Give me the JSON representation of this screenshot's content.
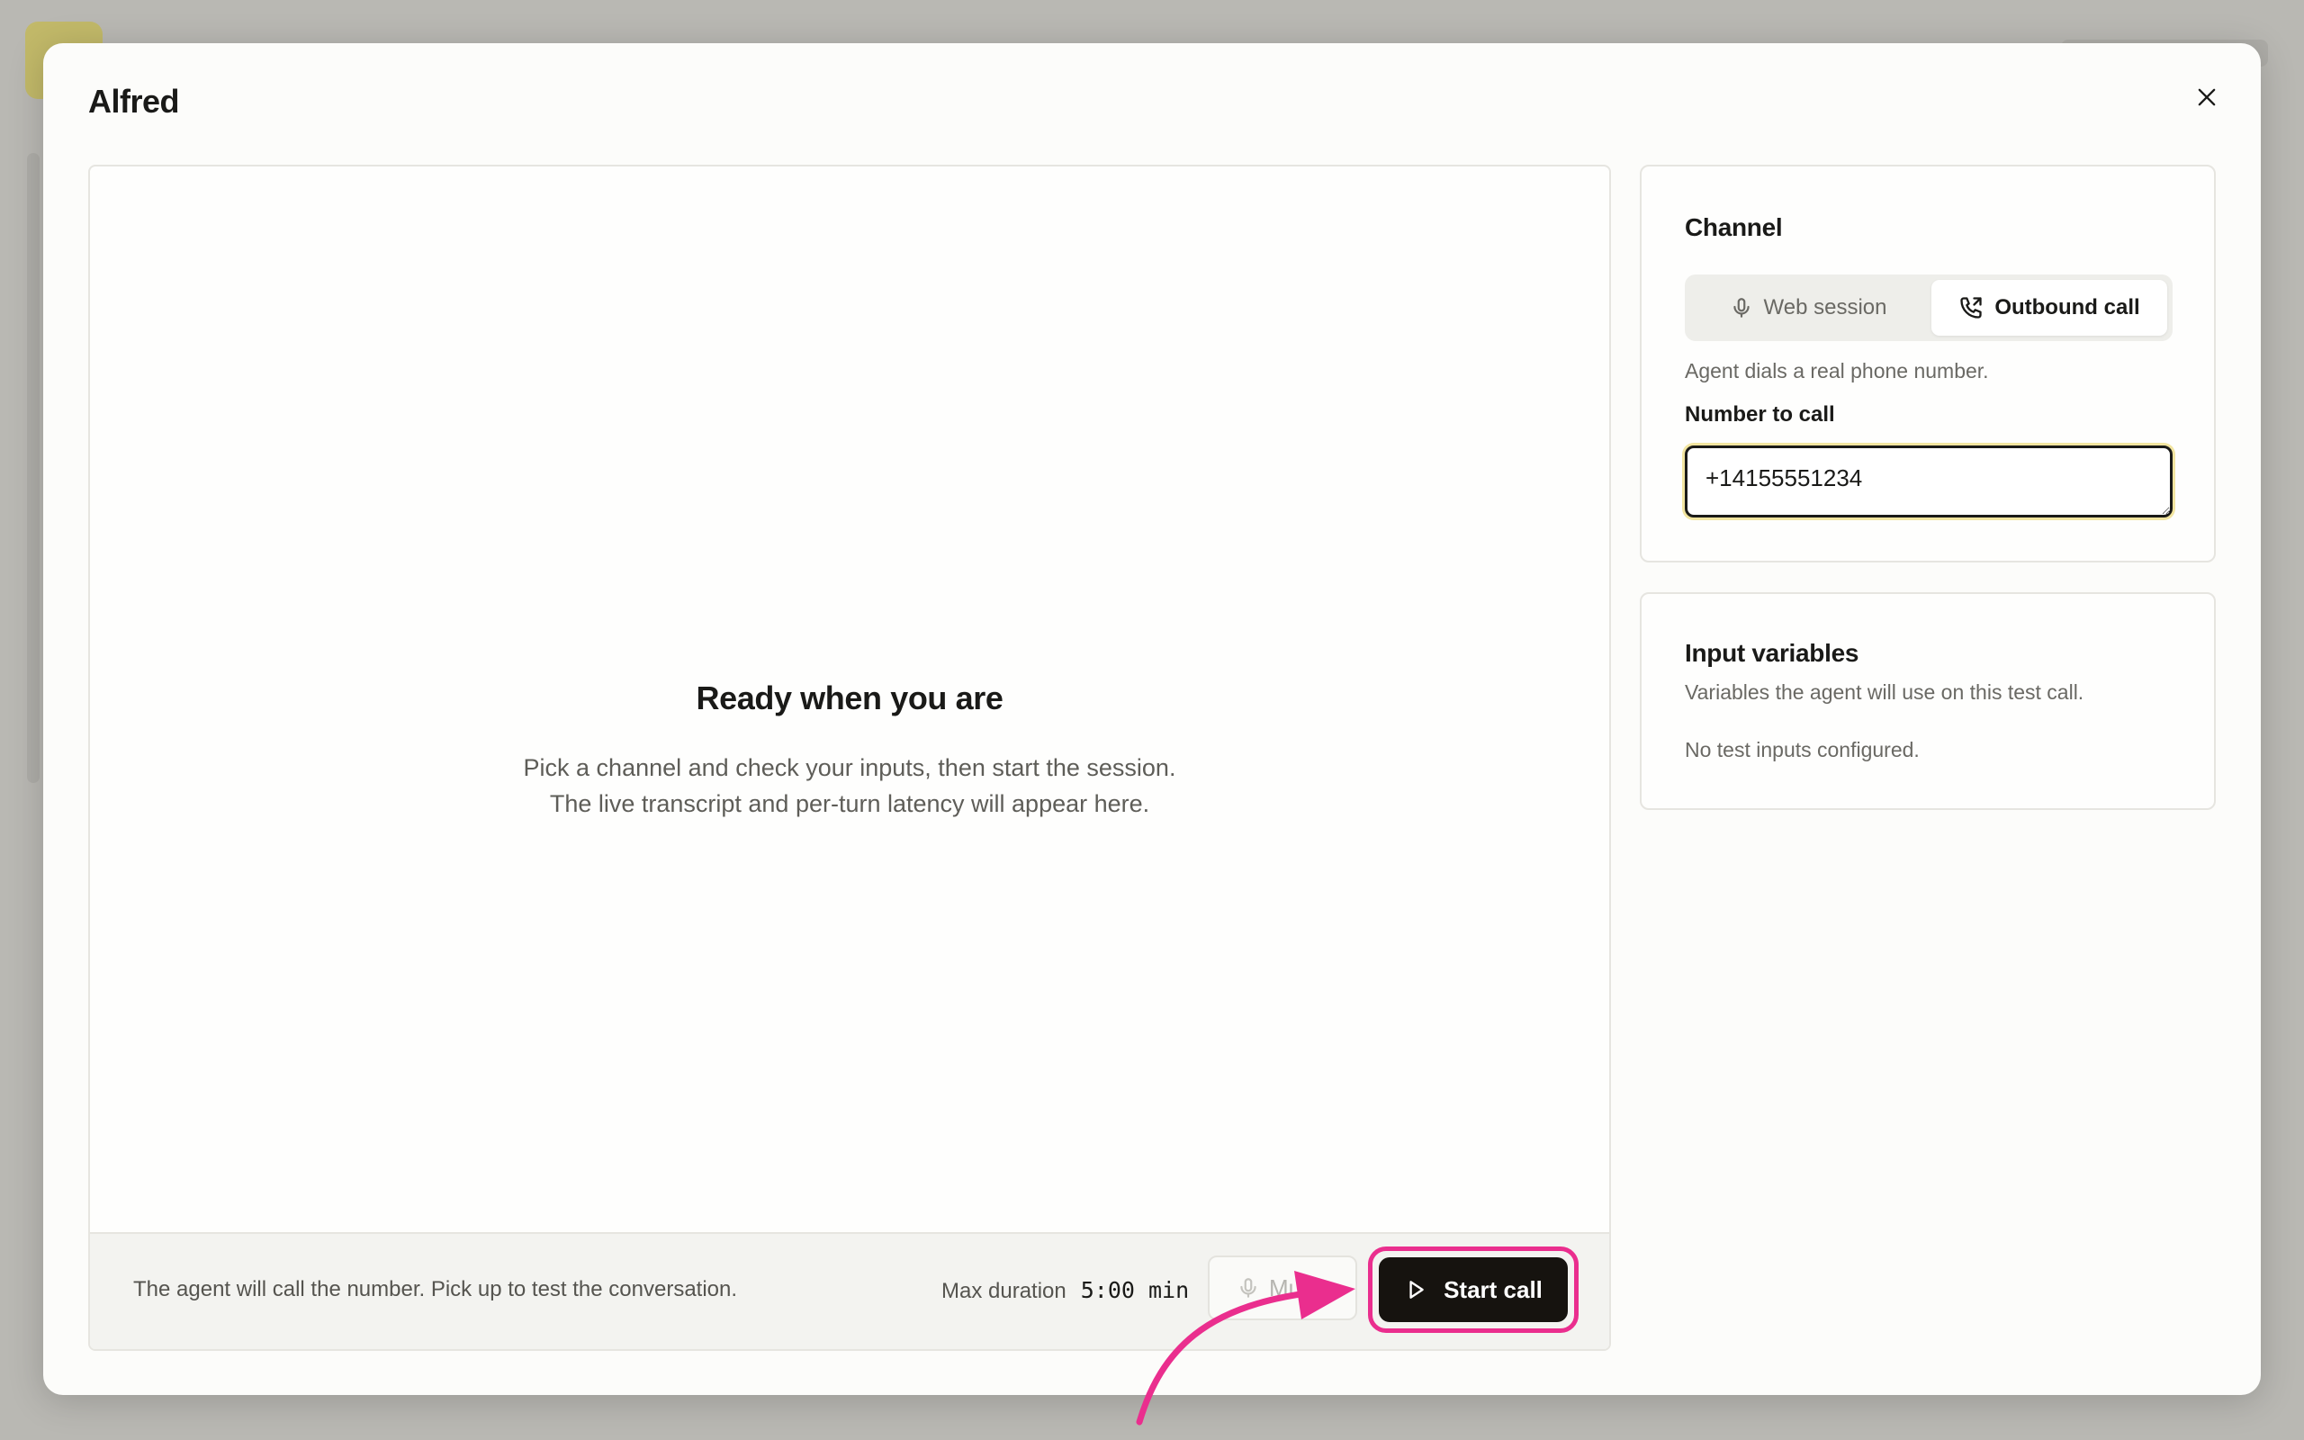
{
  "modal": {
    "title": "Alfred"
  },
  "session": {
    "empty_title": "Ready when you are",
    "empty_line1": "Pick a channel and check your inputs, then start the session.",
    "empty_line2": "The live transcript and per-turn latency will appear here.",
    "footer_note": "The agent will call the number. Pick up to test the conversation.",
    "max_duration_label": "Max duration",
    "max_duration_value": "5:00 min",
    "mute_label": "Mute",
    "start_label": "Start call"
  },
  "channel": {
    "title": "Channel",
    "options": [
      {
        "label": "Web session",
        "icon": "microphone-icon",
        "selected": false
      },
      {
        "label": "Outbound call",
        "icon": "phone-outgoing-icon",
        "selected": true
      }
    ],
    "hint": "Agent dials a real phone number.",
    "number_label": "Number to call",
    "number_value": "+14155551234"
  },
  "input_variables": {
    "title": "Input variables",
    "subtitle": "Variables the agent will use on this test call.",
    "empty": "No test inputs configured."
  },
  "colors": {
    "highlight": "#ea2e8e",
    "primary_button": "#16130f",
    "focus_ring": "#f2e5a0"
  }
}
